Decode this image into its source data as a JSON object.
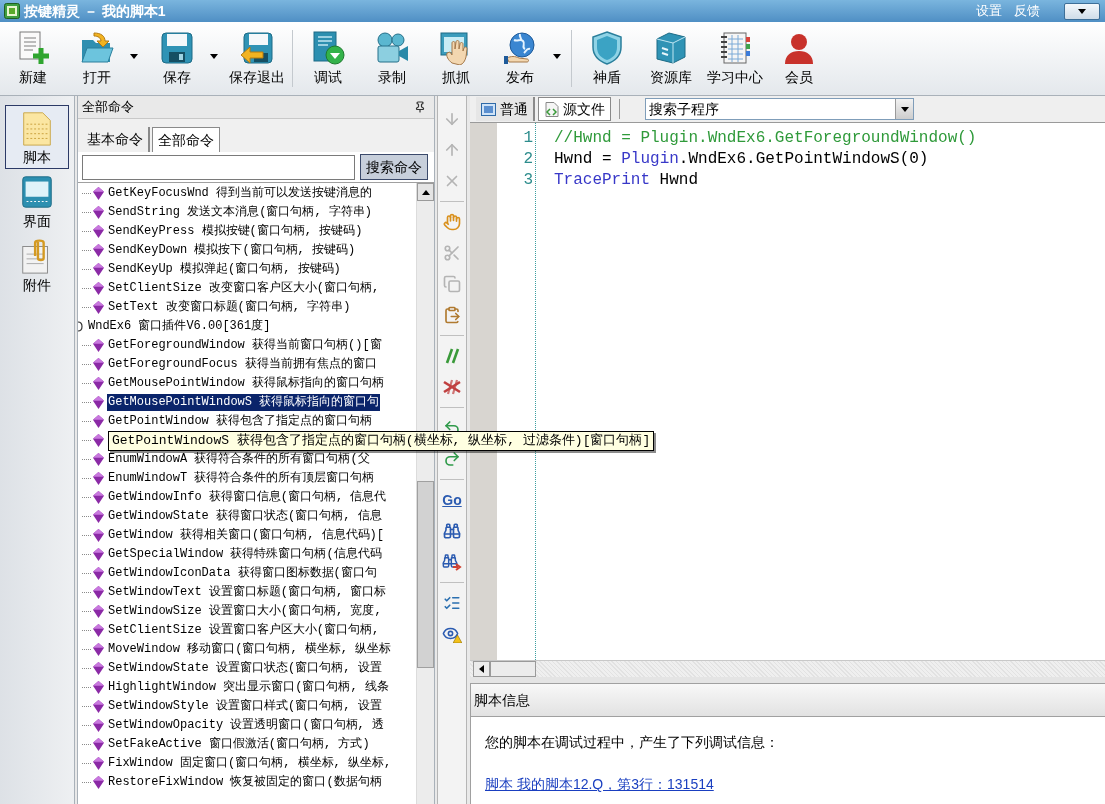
{
  "title_bar": {
    "title": "按键精灵 － 我的脚本1",
    "links": [
      "设置",
      "反馈"
    ]
  },
  "toolbar": {
    "groups": [
      [
        {
          "label": "新建",
          "dropdown": false
        },
        {
          "label": "打开",
          "dropdown": true
        },
        {
          "label": "保存",
          "dropdown": true
        },
        {
          "label": "保存退出",
          "dropdown": false
        }
      ],
      [
        {
          "label": "调试",
          "dropdown": false
        },
        {
          "label": "录制",
          "dropdown": false
        },
        {
          "label": "抓抓",
          "dropdown": false
        },
        {
          "label": "发布",
          "dropdown": true
        }
      ],
      [
        {
          "label": "神盾",
          "dropdown": false
        },
        {
          "label": "资源库",
          "dropdown": false
        },
        {
          "label": "学习中心",
          "dropdown": false
        },
        {
          "label": "会员",
          "dropdown": false
        }
      ]
    ]
  },
  "sidebar": {
    "items": [
      {
        "label": "脚本",
        "selected": true
      },
      {
        "label": "界面",
        "selected": false
      },
      {
        "label": "附件",
        "selected": false
      }
    ]
  },
  "command_panel": {
    "title": "全部命令",
    "tabs": [
      {
        "label": "基本命令",
        "selected": false
      },
      {
        "label": "全部命令",
        "selected": true
      }
    ],
    "search": {
      "button": "搜索命令"
    },
    "tree": [
      {
        "children": [
          {
            "label": "GetKeyFocusWnd 得到当前可以发送按键消息的",
            "selected": false
          },
          {
            "label": "SendString 发送文本消息(窗口句柄, 字符串)",
            "selected": false
          },
          {
            "label": "SendKeyPress 模拟按键(窗口句柄, 按键码)",
            "selected": false
          },
          {
            "label": "SendKeyDown 模拟按下(窗口句柄, 按键码)",
            "selected": false
          },
          {
            "label": "SendKeyUp 模拟弹起(窗口句柄, 按键码)",
            "selected": false
          },
          {
            "label": "SetClientSize 改变窗口客户区大小(窗口句柄,",
            "selected": false
          },
          {
            "label": "SetText 改变窗口标题(窗口句柄, 字符串)",
            "selected": false
          }
        ]
      },
      {
        "label": "WndEx6 窗口插件V6.00[361度]",
        "children": [
          {
            "label": "GetForegroundWindow 获得当前窗口句柄()[窗",
            "selected": false
          },
          {
            "label": "GetForegroundFocus 获得当前拥有焦点的窗口",
            "selected": false
          },
          {
            "label": "GetMousePointWindow 获得鼠标指向的窗口句柄",
            "selected": false
          },
          {
            "label": "GetMousePointWindowS 获得鼠标指向的窗口句",
            "selected": true
          },
          {
            "label": "GetPointWindow 获得包含了指定点的窗口句柄",
            "selected": false
          },
          {
            "tooltip": "GetPointWindowS 获得包含了指定点的窗口句柄(横坐标, 纵坐标, 过滤条件)[窗口句柄]",
            "selected": false
          },
          {
            "label": "EnumWindowA 获得符合条件的所有窗口句柄(父",
            "selected": false
          },
          {
            "label": "EnumWindowT 获得符合条件的所有顶层窗口句柄",
            "selected": false
          },
          {
            "label": "GetWindowInfo 获得窗口信息(窗口句柄, 信息代",
            "selected": false
          },
          {
            "label": "GetWindowState 获得窗口状态(窗口句柄, 信息",
            "selected": false
          },
          {
            "label": "GetWindow 获得相关窗口(窗口句柄, 信息代码)[",
            "selected": false
          },
          {
            "label": "GetSpecialWindow 获得特殊窗口句柄(信息代码",
            "selected": false
          },
          {
            "label": "GetWindowIconData 获得窗口图标数据(窗口句",
            "selected": false
          },
          {
            "label": "SetWindowText 设置窗口标题(窗口句柄, 窗口标",
            "selected": false
          },
          {
            "label": "SetWindowSize 设置窗口大小(窗口句柄, 宽度,",
            "selected": false
          },
          {
            "label": "SetClientSize 设置窗口客户区大小(窗口句柄,",
            "selected": false
          },
          {
            "label": "MoveWindow 移动窗口(窗口句柄, 横坐标, 纵坐标",
            "selected": false
          },
          {
            "label": "SetWindowState 设置窗口状态(窗口句柄, 设置",
            "selected": false
          },
          {
            "label": "HighlightWindow 突出显示窗口(窗口句柄, 线条",
            "selected": false
          },
          {
            "label": "SetWindowStyle 设置窗口样式(窗口句柄, 设置",
            "selected": false
          },
          {
            "label": "SetWindowOpacity 设置透明窗口(窗口句柄, 透",
            "selected": false
          },
          {
            "label": "SetFakeActive 窗口假激活(窗口句柄, 方式)",
            "selected": false
          },
          {
            "label": "FixWindow 固定窗口(窗口句柄, 横坐标, 纵坐标,",
            "selected": false
          },
          {
            "label": "RestoreFixWindow 恢复被固定的窗口(数据句柄",
            "selected": false
          }
        ]
      }
    ]
  },
  "edit_toolbar": {
    "groups": [
      [
        {
          "disabled": true
        },
        {
          "disabled": true
        },
        {
          "disabled": true
        }
      ],
      [
        {
          "disabled": false
        },
        {
          "disabled": true
        },
        {
          "disabled": true
        },
        {
          "disabled": false
        }
      ],
      [
        {
          "disabled": false
        },
        {
          "disabled": false
        }
      ],
      [
        {
          "disabled": false
        },
        {
          "disabled": false
        }
      ],
      [
        {
          "label": "Go",
          "disabled": false
        },
        {
          "disabled": false
        },
        {
          "disabled": false
        }
      ],
      [
        {
          "disabled": false
        },
        {
          "disabled": false
        }
      ]
    ]
  },
  "editor": {
    "tabs": [
      {
        "label": "普通",
        "selected": false
      },
      {
        "label": "源文件",
        "selected": true
      }
    ],
    "subroutine_search": {
      "value": "搜索子程序"
    },
    "lines": [
      {
        "number": "1",
        "tokens": [
          {
            "kind": "comment",
            "text": "//Hwnd = Plugin.WndEx6.GetForegroundWindow()"
          }
        ]
      },
      {
        "number": "2",
        "tokens": [
          {
            "kind": "plain",
            "text": "Hwnd = "
          },
          {
            "kind": "keyword",
            "text": "Plugin"
          },
          {
            "kind": "plain",
            "text": ".WndEx6.GetPointWindowS(0)"
          }
        ]
      },
      {
        "number": "3",
        "tokens": [
          {
            "kind": "keyword",
            "text": "TracePrint"
          },
          {
            "kind": "plain",
            "text": " Hwnd"
          }
        ]
      }
    ]
  },
  "info_panel": {
    "title": "脚本信息",
    "message": "您的脚本在调试过程中，产生了下列调试信息：",
    "link": "脚本 我的脚本12.Q，第3行：131514"
  }
}
